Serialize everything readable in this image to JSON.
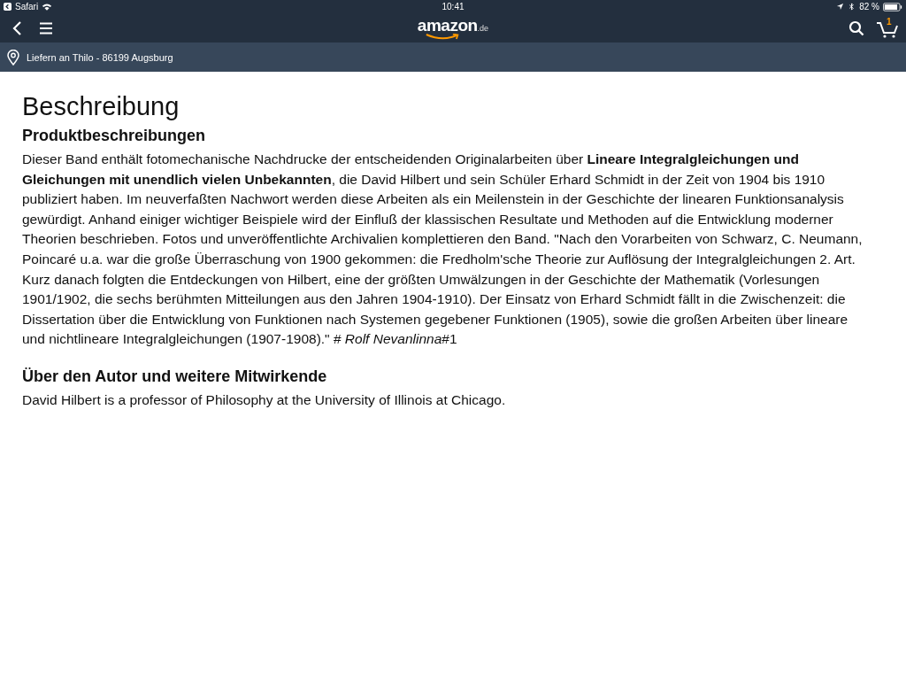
{
  "status_bar": {
    "back_app": "Safari",
    "time": "10:41",
    "battery": "82 %"
  },
  "header": {
    "logo": "amazon",
    "logo_suffix": ".de",
    "cart_count": "1"
  },
  "delivery": {
    "label": "Liefern an Thilo - 86199 Augsburg"
  },
  "content": {
    "title": "Beschreibung",
    "sections": [
      {
        "heading": "Produktbeschreibungen",
        "text": "Dieser Band enthält fotomechanische Nachdrucke der entscheidenden Originalarbeiten über **Lineare Integralgleichungen und Gleichungen mit unendlich vielen Unbekannten**, die David Hilbert und sein Schüler Erhard Schmidt in der Zeit von 1904 bis 1910 publiziert haben. Im neuverfaßten Nachwort werden diese Arbeiten als ein Meilenstein in der Geschichte der linearen Funktionsanalysis gewürdigt. Anhand einiger wichtiger Beispiele wird der Einfluß der klassischen Resultate und Methoden auf die Entwicklung moderner Theorien beschrieben. Fotos und unveröffentlichte Archivalien komplettieren den Band. \"Nach den Vorarbeiten von Schwarz, C. Neumann, Poincaré u.a. war die große Überraschung von 1900 gekommen: die Fredholm'sche Theorie zur Auflösung der Integralgleichungen 2. Art. Kurz danach folgten die Entdeckungen von Hilbert, eine der größten Umwälzungen in der Geschichte der Mathematik (Vorlesungen 1901/1902, die sechs berühmten Mitteilungen aus den Jahren 1904-1910). Der Einsatz von Erhard Schmidt fällt in die Zwischenzeit: die Dissertation über die Entwicklung von Funktionen nach Systemen gegebener Funktionen (1905), sowie die großen Arbeiten über lineare und nichtlineare Integralgleichungen (1907-1908).\" # *Rolf Nevanlinna*#1"
      },
      {
        "heading": "Über den Autor und weitere Mitwirkende",
        "text": "David Hilbert is a professor of Philosophy at the University of Illinois at Chicago."
      }
    ]
  }
}
